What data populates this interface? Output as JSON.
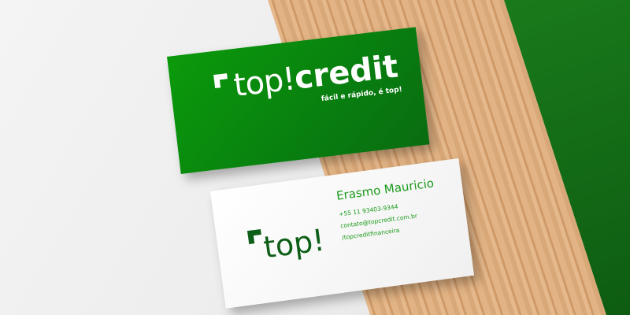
{
  "brand": {
    "logo_part1": "top!",
    "logo_part2": "credit",
    "tagline": "fácil e rápido, é top!",
    "short_logo": "top!"
  },
  "contact": {
    "name": "Erasmo Mauricio",
    "phone": "+55 11 93403-9344",
    "email": "contato@topcredit.com.br",
    "social": "/topcreditfinanceira"
  },
  "colors": {
    "brand_green": "#0b9a0b",
    "dark_green": "#0d5e17",
    "wood": "#e0b084"
  }
}
